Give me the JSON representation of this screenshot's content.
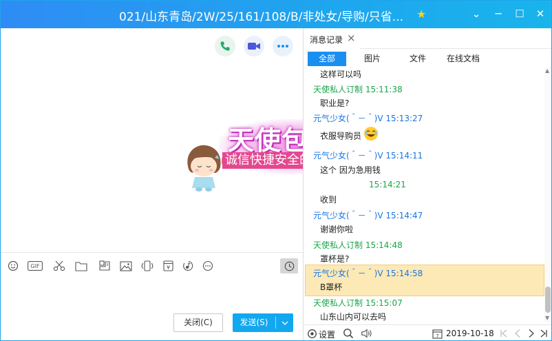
{
  "window": {
    "title": "021/山东青岛/2W/25/161/108/B/非处女/导购/只省...",
    "star_icon": "★",
    "minimize": "─",
    "maximize": "☐",
    "close": "✕",
    "chevron": "⌄"
  },
  "watermark": {
    "main": "天使包养网",
    "sub": "诚信快捷安全的交友平台",
    "partial": "叫"
  },
  "actions": {
    "close_label": "关闭(C)",
    "send_label": "发送(S)"
  },
  "record": {
    "tab_label": "消息记录",
    "filters": [
      "全部",
      "图片",
      "文件",
      "在线文档"
    ],
    "messages": [
      {
        "kind": "content",
        "text": "这样可以吗"
      },
      {
        "kind": "sender",
        "text": "天使私人订制 15:11:38",
        "color": "#19a64b"
      },
      {
        "kind": "content",
        "text": "职业是?"
      },
      {
        "kind": "sender",
        "text": "元气少女(＾－＾)V 15:13:27",
        "color": "#1776e5"
      },
      {
        "kind": "content",
        "text": "衣服导购员"
      },
      {
        "kind": "sender",
        "text": "元气少女(＾－＾)V 15:14:11",
        "color": "#1776e5"
      },
      {
        "kind": "content",
        "text": "这个 因为急用钱"
      },
      {
        "kind": "sender",
        "text": "15:14:21",
        "color": "#19a64b"
      },
      {
        "kind": "content",
        "text": "收到"
      },
      {
        "kind": "sender",
        "text": "元气少女(＾－＾)V 15:14:47",
        "color": "#1776e5"
      },
      {
        "kind": "content",
        "text": "谢谢你啦"
      },
      {
        "kind": "sender",
        "text": "天使私人订制 15:14:48",
        "color": "#19a64b"
      },
      {
        "kind": "content",
        "text": "罩杯是?"
      },
      {
        "kind": "sender",
        "text": "元气少女(＾－＾)V 15:14:58",
        "color": "#1776e5"
      },
      {
        "kind": "content",
        "text": "B罩杯"
      },
      {
        "kind": "sender",
        "text": "天使私人订制 15:15:07",
        "color": "#19a64b"
      },
      {
        "kind": "content",
        "text": "山东山内可以去吗"
      }
    ],
    "settings_label": "设置",
    "date": "2019-10-18"
  },
  "colors": {
    "accent": "#1a8ff0",
    "send": "#12a8f0",
    "green_sender": "#19a64b",
    "blue_sender": "#1776e5",
    "highlight": "#fde9b6"
  }
}
